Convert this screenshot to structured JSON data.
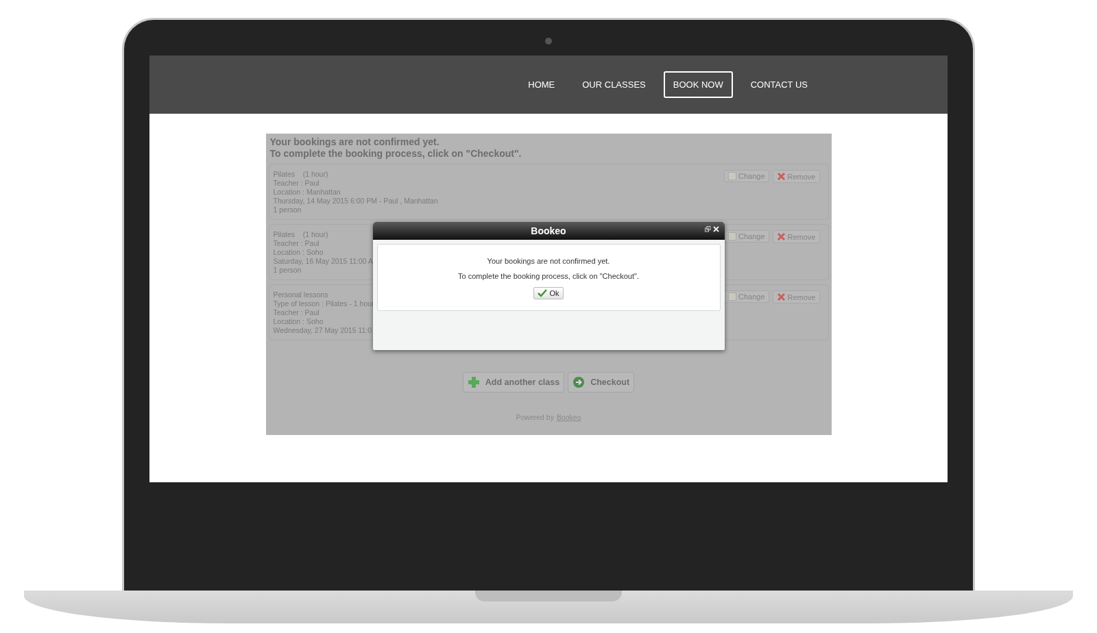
{
  "nav": {
    "items": [
      {
        "label": "HOME",
        "selected": false
      },
      {
        "label": "OUR CLASSES",
        "selected": false
      },
      {
        "label": "BOOK NOW",
        "selected": true
      },
      {
        "label": "CONTACT US",
        "selected": false
      }
    ]
  },
  "booking": {
    "heading": [
      "Your bookings are not confirmed yet.",
      "To complete the booking process, click on \"Checkout\"."
    ],
    "items": [
      {
        "lines": [
          "Pilates    (1 hour)",
          "Teacher : Paul",
          "Location : Manhattan",
          "Thursday, 14 May 2015 6:00 PM - Paul , Manhattan",
          "1 person"
        ],
        "actions": [
          "Change",
          "Remove"
        ]
      },
      {
        "lines": [
          "Pilates    (1 hour)",
          "Teacher : Paul",
          "Location : Soho",
          "Saturday, 16 May 2015 11:00 A",
          "1 person"
        ],
        "actions": [
          "Change",
          "Remove"
        ]
      },
      {
        "lines": [
          "Personal lessons",
          "Type of lesson : Pilates - 1 hour",
          "Teacher : Paul",
          "Location : Soho",
          "Wednesday, 27 May 2015 11:0"
        ],
        "actions": [
          "Change",
          "Remove"
        ]
      }
    ],
    "buttons": [
      {
        "label": "Add another class",
        "kind": "add"
      },
      {
        "label": "Checkout",
        "kind": "checkout"
      }
    ],
    "footer": {
      "text": "Powered by",
      "link": "Bookeo"
    }
  },
  "dialog": {
    "title": "Bookeo",
    "messages": [
      "Your bookings are not confirmed yet.",
      "To complete the booking process, click on \"Checkout\"."
    ],
    "ok_button": "Ok"
  }
}
